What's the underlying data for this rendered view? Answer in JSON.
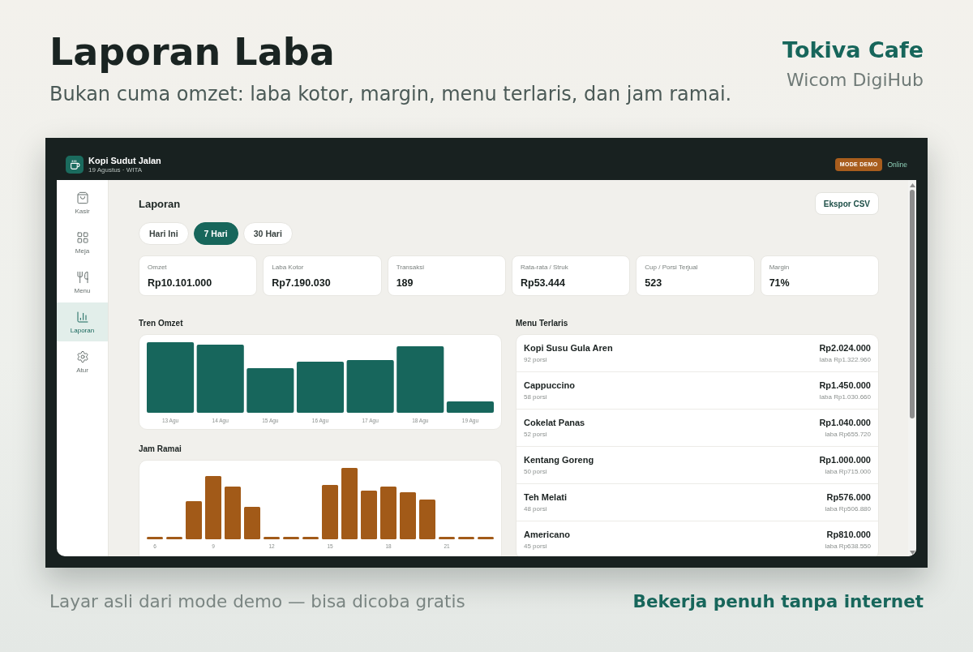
{
  "header": {
    "title": "Laporan Laba",
    "subtitle": "Bukan cuma omzet: laba kotor, margin, menu terlaris, dan jam ramai.",
    "brand": "Tokiva Cafe",
    "company": "Wicom DigiHub"
  },
  "app": {
    "topbar": {
      "store_name": "Kopi Sudut Jalan",
      "store_info": "19 Agustus · WITA",
      "badge": "MODE DEMO",
      "status": "Online"
    },
    "sidebar": {
      "items": [
        {
          "label": "Kasir",
          "selected": false
        },
        {
          "label": "Meja",
          "selected": false
        },
        {
          "label": "Menu",
          "selected": false
        },
        {
          "label": "Laporan",
          "selected": true
        },
        {
          "label": "Atur",
          "selected": false
        }
      ]
    },
    "page_title": "Laporan",
    "export_button": "Ekspor CSV",
    "period_tabs": [
      {
        "label": "Hari Ini",
        "selected": false
      },
      {
        "label": "7 Hari",
        "selected": true
      },
      {
        "label": "30 Hari",
        "selected": false
      }
    ],
    "stats": [
      {
        "label": "Omzet",
        "value": "Rp10.101.000"
      },
      {
        "label": "Laba Kotor",
        "value": "Rp7.190.030"
      },
      {
        "label": "Transaksi",
        "value": "189"
      },
      {
        "label": "Rata-rata / Struk",
        "value": "Rp53.444"
      },
      {
        "label": "Cup / Porsi Terjual",
        "value": "523"
      },
      {
        "label": "Margin",
        "value": "71%"
      }
    ],
    "revenue_trend": {
      "title": "Tren Omzet",
      "labels": [
        "13 Agu",
        "14 Agu",
        "15 Agu",
        "16 Agu",
        "17 Agu",
        "18 Agu",
        "19 Agu"
      ]
    },
    "peak_hours": {
      "title": "Jam Ramai",
      "labels": [
        "6",
        "9",
        "12",
        "15",
        "18",
        "21"
      ]
    },
    "top_menu": {
      "title": "Menu Terlaris",
      "items": [
        {
          "name": "Kopi Susu Gula Aren",
          "portions": "92 porsi",
          "revenue": "Rp2.024.000",
          "profit": "laba Rp1.322.960"
        },
        {
          "name": "Cappuccino",
          "portions": "58 porsi",
          "revenue": "Rp1.450.000",
          "profit": "laba Rp1.030.660"
        },
        {
          "name": "Cokelat Panas",
          "portions": "52 porsi",
          "revenue": "Rp1.040.000",
          "profit": "laba Rp655.720"
        },
        {
          "name": "Kentang Goreng",
          "portions": "50 porsi",
          "revenue": "Rp1.000.000",
          "profit": "laba Rp715.000"
        },
        {
          "name": "Teh Melati",
          "portions": "48 porsi",
          "revenue": "Rp576.000",
          "profit": "laba Rp506.880"
        },
        {
          "name": "Americano",
          "portions": "45 porsi",
          "revenue": "Rp810.000",
          "profit": "laba Rp638.550"
        }
      ]
    }
  },
  "footer": {
    "note": "Layar asli dari mode demo — bisa dicoba gratis",
    "tagline": "Bekerja penuh tanpa internet"
  }
}
